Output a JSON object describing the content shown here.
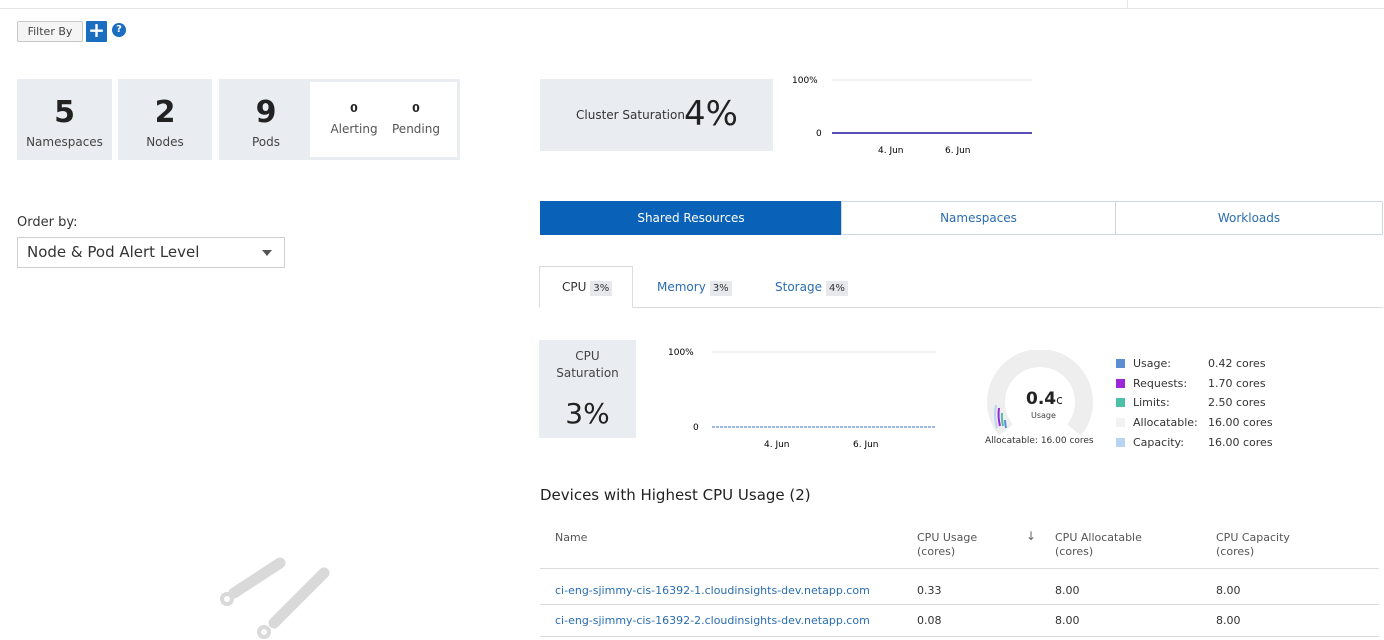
{
  "toolbar": {
    "filter_label": "Filter By",
    "add_symbol": "+",
    "help_symbol": "?"
  },
  "stats": [
    {
      "value": "5",
      "label": "Namespaces"
    },
    {
      "value": "2",
      "label": "Nodes"
    },
    {
      "value": "9",
      "label": "Pods"
    }
  ],
  "pod_status": [
    {
      "value": "0",
      "label": "Alerting"
    },
    {
      "value": "0",
      "label": "Pending"
    }
  ],
  "cluster_saturation": {
    "label": "Cluster Saturation",
    "value": "4%",
    "chart_y_top": "100%",
    "chart_y_bottom": "0",
    "chart_x_ticks": [
      "4. Jun",
      "6. Jun"
    ]
  },
  "order_by": {
    "label": "Order by:",
    "selected": "Node & Pod Alert Level"
  },
  "main_tabs": [
    "Shared Resources",
    "Namespaces",
    "Workloads"
  ],
  "sub_tabs": [
    {
      "label": "CPU",
      "pct": "3%"
    },
    {
      "label": "Memory",
      "pct": "3%"
    },
    {
      "label": "Storage",
      "pct": "4%"
    }
  ],
  "cpu": {
    "label_line1": "CPU",
    "label_line2": "Saturation",
    "value": "3%",
    "chart_y_top": "100%",
    "chart_y_bottom": "0",
    "chart_x_ticks": [
      "4. Jun",
      "6. Jun"
    ],
    "gauge_value": "0.4",
    "gauge_unit_suffix": "c",
    "gauge_caption": "Usage",
    "gauge_allocatable": "Allocatable: 16.00 cores",
    "gauge_fraction": 0.025
  },
  "legend": [
    {
      "name": "Usage:",
      "value": "0.42 cores",
      "color": "#5b8fd1"
    },
    {
      "name": "Requests:",
      "value": "1.70 cores",
      "color": "#9b27d6"
    },
    {
      "name": "Limits:",
      "value": "2.50 cores",
      "color": "#4cc0a8"
    },
    {
      "name": "Allocatable:",
      "value": "16.00 cores",
      "color": "#f2f2f2"
    },
    {
      "name": "Capacity:",
      "value": "16.00 cores",
      "color": "#b8d4f2"
    }
  ],
  "devices": {
    "title": "Devices with Highest CPU Usage (2)",
    "columns": [
      {
        "line1": "Name",
        "line2": ""
      },
      {
        "line1": "CPU Usage",
        "line2": "(cores)"
      },
      {
        "line1": "CPU Allocatable",
        "line2": "(cores)"
      },
      {
        "line1": "CPU Capacity",
        "line2": "(cores)"
      }
    ],
    "sort_arrow": "↓",
    "rows": [
      {
        "name": "ci-eng-sjimmy-cis-16392-1.cloudinsights-dev.netapp.com",
        "usage": "0.33",
        "allocatable": "8.00",
        "capacity": "8.00"
      },
      {
        "name": "ci-eng-sjimmy-cis-16392-2.cloudinsights-dev.netapp.com",
        "usage": "0.08",
        "allocatable": "8.00",
        "capacity": "8.00"
      }
    ]
  },
  "colors": {
    "accent": "#0a62b8",
    "tile_bg": "#e9edf2",
    "link": "#2a6db0"
  }
}
